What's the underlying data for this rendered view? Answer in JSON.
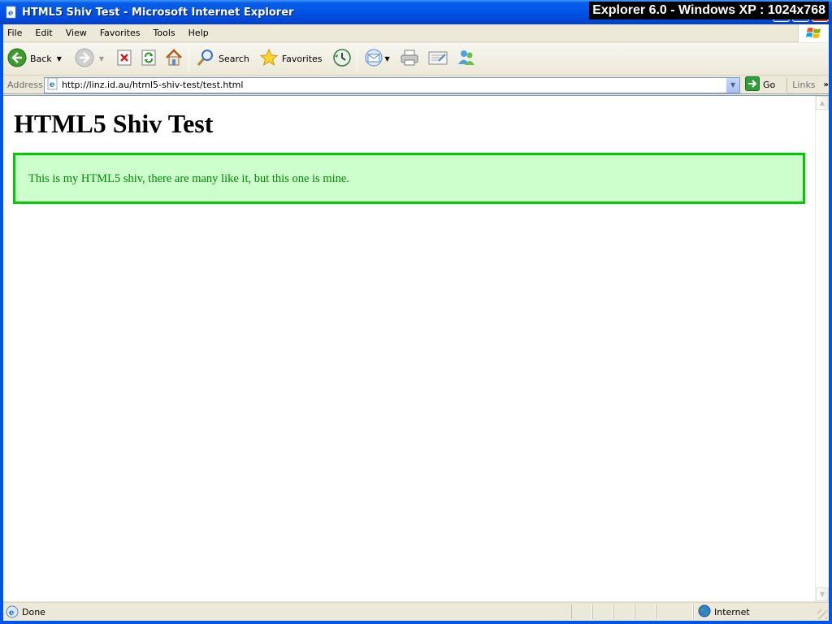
{
  "window": {
    "title": "HTML5 Shiv Test - Microsoft Internet Explorer",
    "overlay_caption": "Explorer 6.0 - Windows XP : 1024x768"
  },
  "menu": {
    "items": [
      "File",
      "Edit",
      "View",
      "Favorites",
      "Tools",
      "Help"
    ]
  },
  "toolbar": {
    "back_label": "Back",
    "search_label": "Search",
    "favorites_label": "Favorites",
    "icons": [
      "back-icon",
      "forward-icon",
      "stop-icon",
      "refresh-icon",
      "home-icon",
      "search-icon",
      "favorites-star-icon",
      "history-icon",
      "mail-icon",
      "print-icon",
      "edit-icon",
      "messenger-icon"
    ]
  },
  "address": {
    "label": "Address",
    "url": "http://linz.id.au/html5-shiv-test/test.html",
    "go_label": "Go",
    "links_label": "Links"
  },
  "page": {
    "heading": "HTML5 Shiv Test",
    "shiv_text": "This is my HTML5 shiv, there are many like it, but this one is mine."
  },
  "status": {
    "text": "Done",
    "zone": "Internet"
  },
  "colors": {
    "shiv_background": "#ccffcc",
    "shiv_border": "#00cc00",
    "shiv_text": "#008800",
    "titlebar": "#0055e5"
  }
}
